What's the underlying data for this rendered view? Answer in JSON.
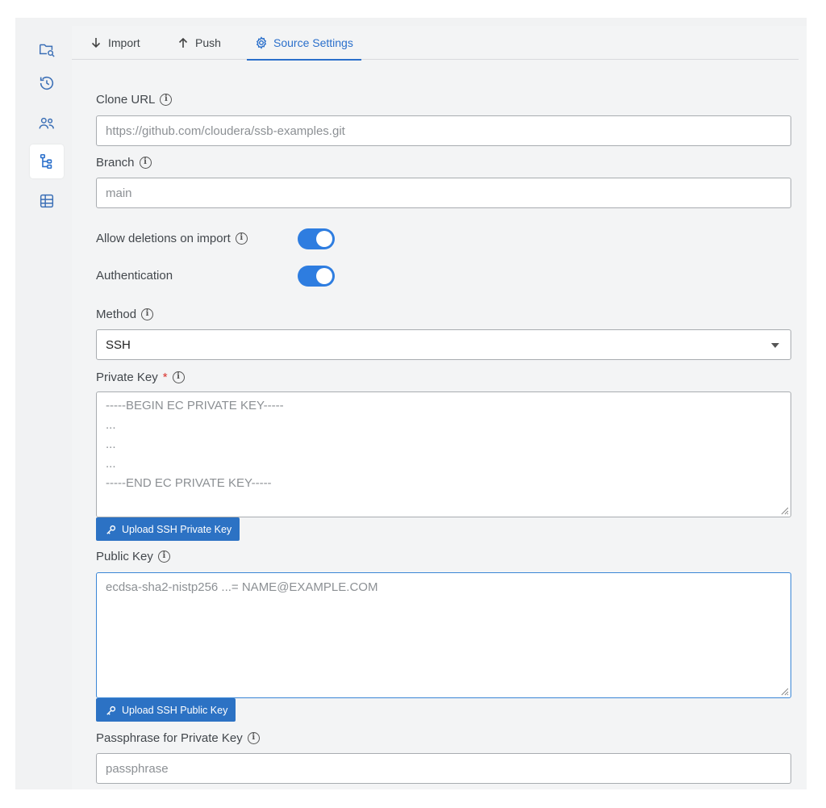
{
  "rail": {
    "items": [
      {
        "icon": "folder-search-icon"
      },
      {
        "icon": "history-icon"
      },
      {
        "icon": "users-icon"
      },
      {
        "icon": "source-tree-icon",
        "active": true
      },
      {
        "icon": "table-list-icon"
      }
    ]
  },
  "tabs": [
    {
      "label": "Import",
      "icon": "arrow-down-icon"
    },
    {
      "label": "Push",
      "icon": "arrow-up-icon"
    },
    {
      "label": "Source Settings",
      "icon": "gear-icon",
      "active": true
    }
  ],
  "form": {
    "clone_url": {
      "label": "Clone URL",
      "value": "https://github.com/cloudera/ssb-examples.git"
    },
    "branch": {
      "label": "Branch",
      "value": "main"
    },
    "allow_deletions": {
      "label": "Allow deletions on import",
      "on": true
    },
    "authentication": {
      "label": "Authentication",
      "on": true
    },
    "method": {
      "label": "Method",
      "value": "SSH"
    },
    "private_key": {
      "label": "Private Key",
      "required_mark": "*",
      "placeholder_lines": [
        "-----BEGIN EC PRIVATE KEY-----",
        "...",
        "...",
        "...",
        "-----END EC PRIVATE KEY-----"
      ],
      "upload_label": "Upload SSH Private Key"
    },
    "public_key": {
      "label": "Public Key",
      "placeholder": "ecdsa-sha2-nistp256 ...= NAME@EXAMPLE.COM",
      "upload_label": "Upload SSH Public Key"
    },
    "passphrase": {
      "label": "Passphrase for Private Key",
      "placeholder": "passphrase"
    }
  },
  "colors": {
    "accent": "#2a6fcb",
    "button": "#2c72c4",
    "toggle": "#2e7de0",
    "required": "#d9302b"
  }
}
